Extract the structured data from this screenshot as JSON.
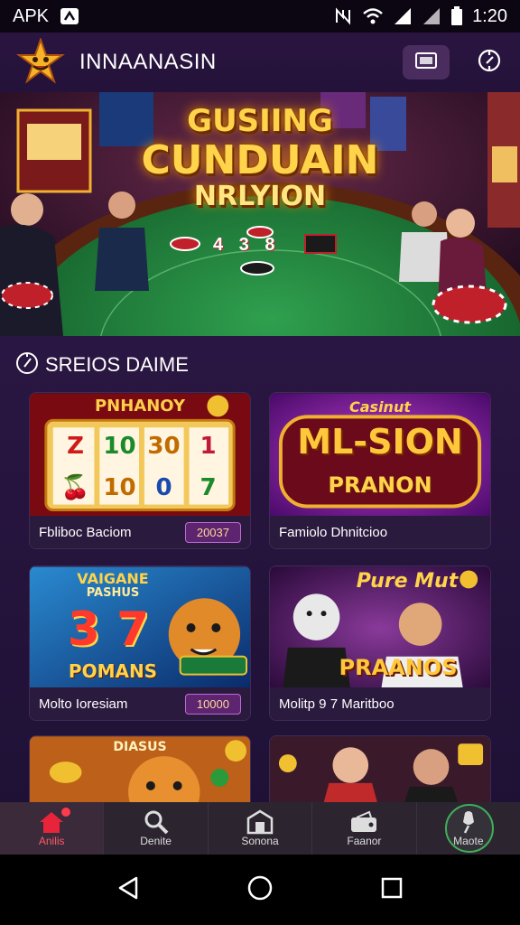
{
  "status_bar": {
    "left_text": "APK",
    "time": "1:20",
    "icons": [
      "apk-notification-icon",
      "nfc-icon",
      "wifi-icon",
      "cell-signal-icon",
      "cell-signal-icon",
      "battery-icon"
    ]
  },
  "header": {
    "title": "INNAANASIN",
    "logo": "star-mascot-logo",
    "actions": [
      "wallet-icon",
      "compass-icon"
    ]
  },
  "banner": {
    "line1": "GUSIING",
    "line2": "CUNDUAIN",
    "line3": "NRLYION",
    "chips_text": "4 3 8"
  },
  "section": {
    "icon": "compass-icon",
    "title": "SREIOS DAIME"
  },
  "games": [
    {
      "title": "Fbliboc Baciom",
      "badge": "20037",
      "art_heading": "PNHANOY",
      "reels": [
        "Z",
        "10",
        "30",
        "1",
        "🍒",
        "10",
        "0",
        "7"
      ]
    },
    {
      "title": "Famiolo Dhnitcioo",
      "badge": "",
      "art_heading": "Casinut",
      "art_line1": "ML-SION",
      "art_line2": "PRANON"
    },
    {
      "title": "Molto Ioresiam",
      "badge": "10000",
      "art_heading": "VAIGANE",
      "art_sub": "PASHUS",
      "art_line1": "3 7",
      "art_line2": "POMANS"
    },
    {
      "title": "Molitp 9 7 Maritboo",
      "badge": "",
      "art_heading": "Pure Mut",
      "art_line2": "PRAANOS"
    },
    {
      "title": "",
      "badge": "",
      "art_heading": "DIASUS"
    },
    {
      "title": "",
      "badge": "",
      "art_heading": ""
    }
  ],
  "bottom_nav": [
    {
      "label": "Anilis",
      "icon": "home-icon",
      "active": true
    },
    {
      "label": "Denite",
      "icon": "search-icon",
      "active": false
    },
    {
      "label": "Sonona",
      "icon": "building-icon",
      "active": false
    },
    {
      "label": "Faanor",
      "icon": "wallet-icon",
      "active": false
    },
    {
      "label": "Maote",
      "icon": "microphone-icon",
      "active": false
    }
  ],
  "system_nav": [
    "back-icon",
    "home-circle-icon",
    "recents-icon"
  ],
  "colors": {
    "accent": "#ff5a6a",
    "header_bg": "#24123a",
    "gold": "#ffd34a",
    "felt": "#1e7a3a"
  }
}
